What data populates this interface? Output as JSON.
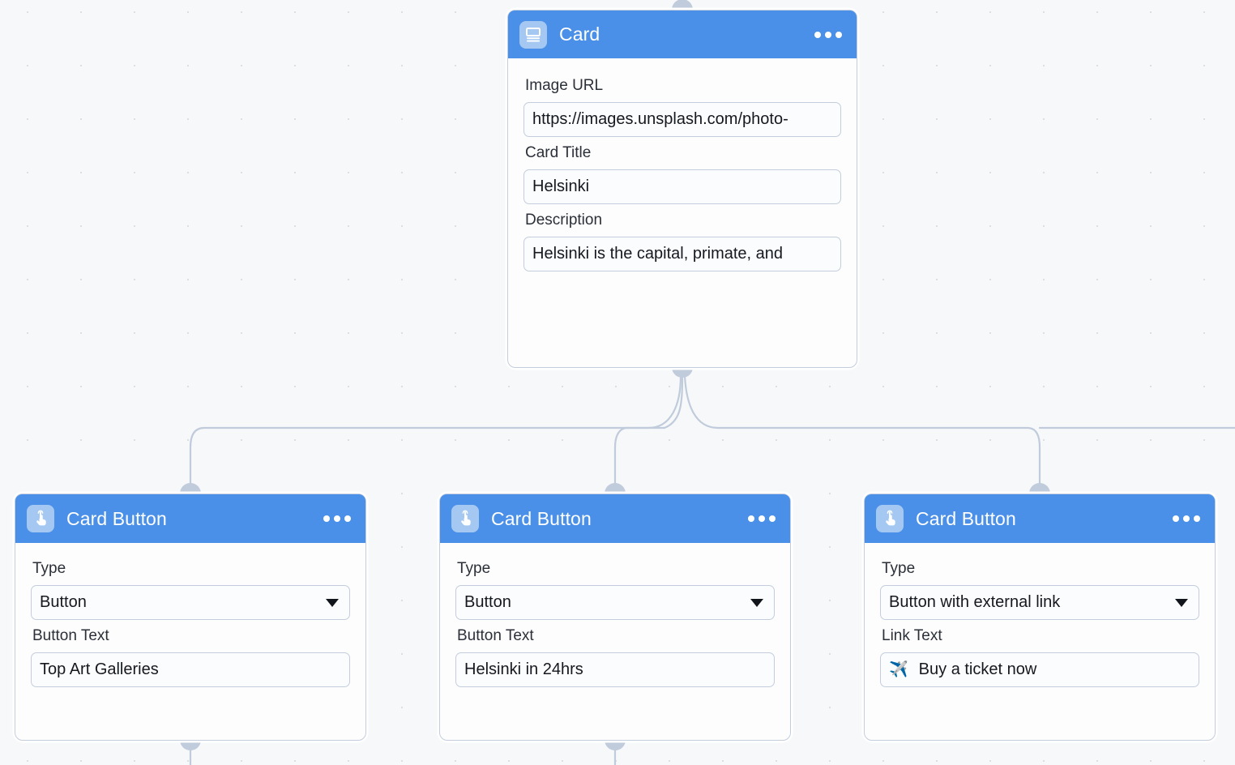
{
  "canvas": {
    "background_color": "#f7f8f9",
    "grid_dot_color": "#dcdee0",
    "accent_color": "#4a90e8",
    "node_border_color": "#c3cddd",
    "edge_color": "#c0cbdb"
  },
  "nodes": [
    {
      "id": "card",
      "title": "Card",
      "icon": "card-article-icon",
      "menu": "more-options-icon",
      "fields": [
        {
          "label": "Image URL",
          "value": "https://images.unsplash.com/photo-",
          "kind": "text"
        },
        {
          "label": "Card Title",
          "value": "Helsinki",
          "kind": "text"
        },
        {
          "label": "Description",
          "value": "Helsinki is the capital, primate, and ",
          "kind": "text"
        }
      ]
    },
    {
      "id": "card_button_1",
      "title": "Card Button",
      "icon": "tap-hand-icon",
      "menu": "more-options-icon",
      "fields": [
        {
          "label": "Type",
          "value": "Button",
          "kind": "select"
        },
        {
          "label": "Button Text",
          "value": "Top Art Galleries",
          "kind": "text"
        }
      ]
    },
    {
      "id": "card_button_2",
      "title": "Card Button",
      "icon": "tap-hand-icon",
      "menu": "more-options-icon",
      "fields": [
        {
          "label": "Type",
          "value": "Button",
          "kind": "select"
        },
        {
          "label": "Button Text",
          "value": "Helsinki in 24hrs",
          "kind": "text"
        }
      ]
    },
    {
      "id": "card_button_3",
      "title": "Card Button",
      "icon": "tap-hand-icon",
      "menu": "more-options-icon",
      "fields": [
        {
          "label": "Type",
          "value": "Button with external link",
          "kind": "select"
        },
        {
          "label": "Link Text",
          "value": "Buy a ticket now",
          "kind": "text",
          "emoji": "✈️"
        }
      ]
    }
  ]
}
